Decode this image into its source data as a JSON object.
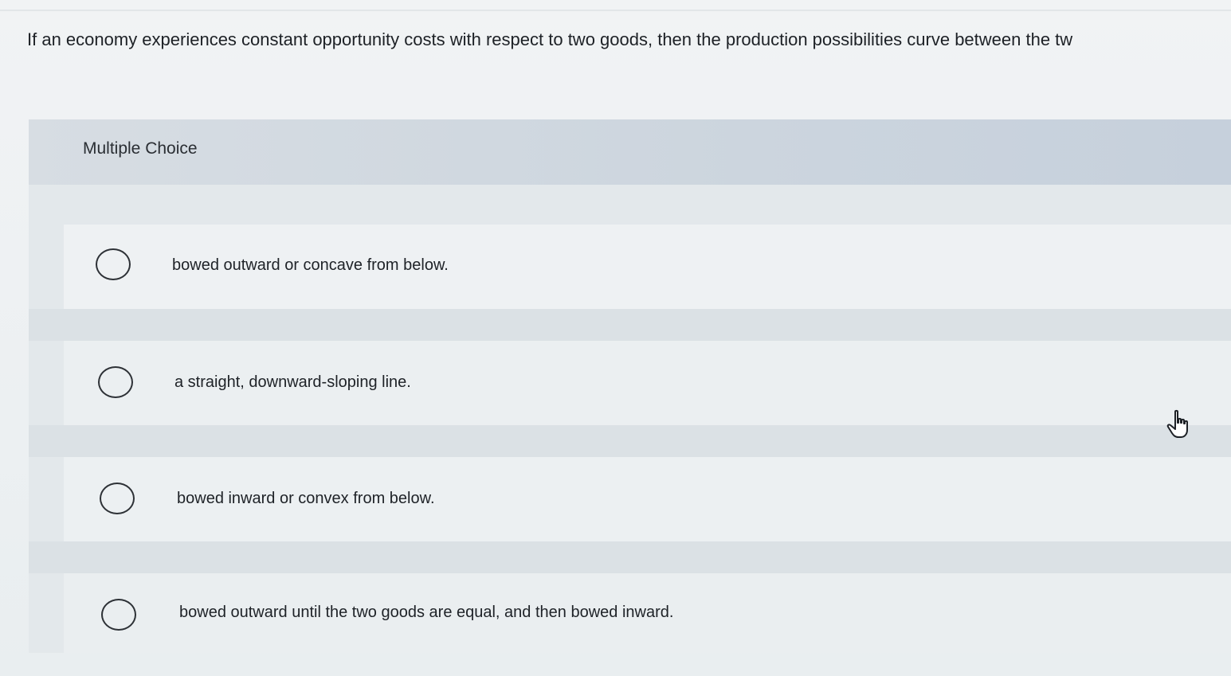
{
  "question": {
    "text": "If an economy experiences constant opportunity costs with respect to two goods, then the production possibilities curve between the tw"
  },
  "choice_block": {
    "title": "Multiple Choice",
    "options": [
      {
        "label": "bowed outward or concave from below.",
        "selected": false
      },
      {
        "label": "a straight, downward-sloping line.",
        "selected": false
      },
      {
        "label": "bowed inward or convex from below.",
        "selected": false
      },
      {
        "label": "bowed outward until the two goods are equal, and then bowed inward.",
        "selected": false
      }
    ]
  },
  "cursor": {
    "icon": "hand-pointer-icon"
  },
  "colors": {
    "header_bg": "#ccd5de",
    "panel_bg": "#e3e8eb",
    "radio_border": "#2d3136",
    "text": "#1e2227"
  }
}
